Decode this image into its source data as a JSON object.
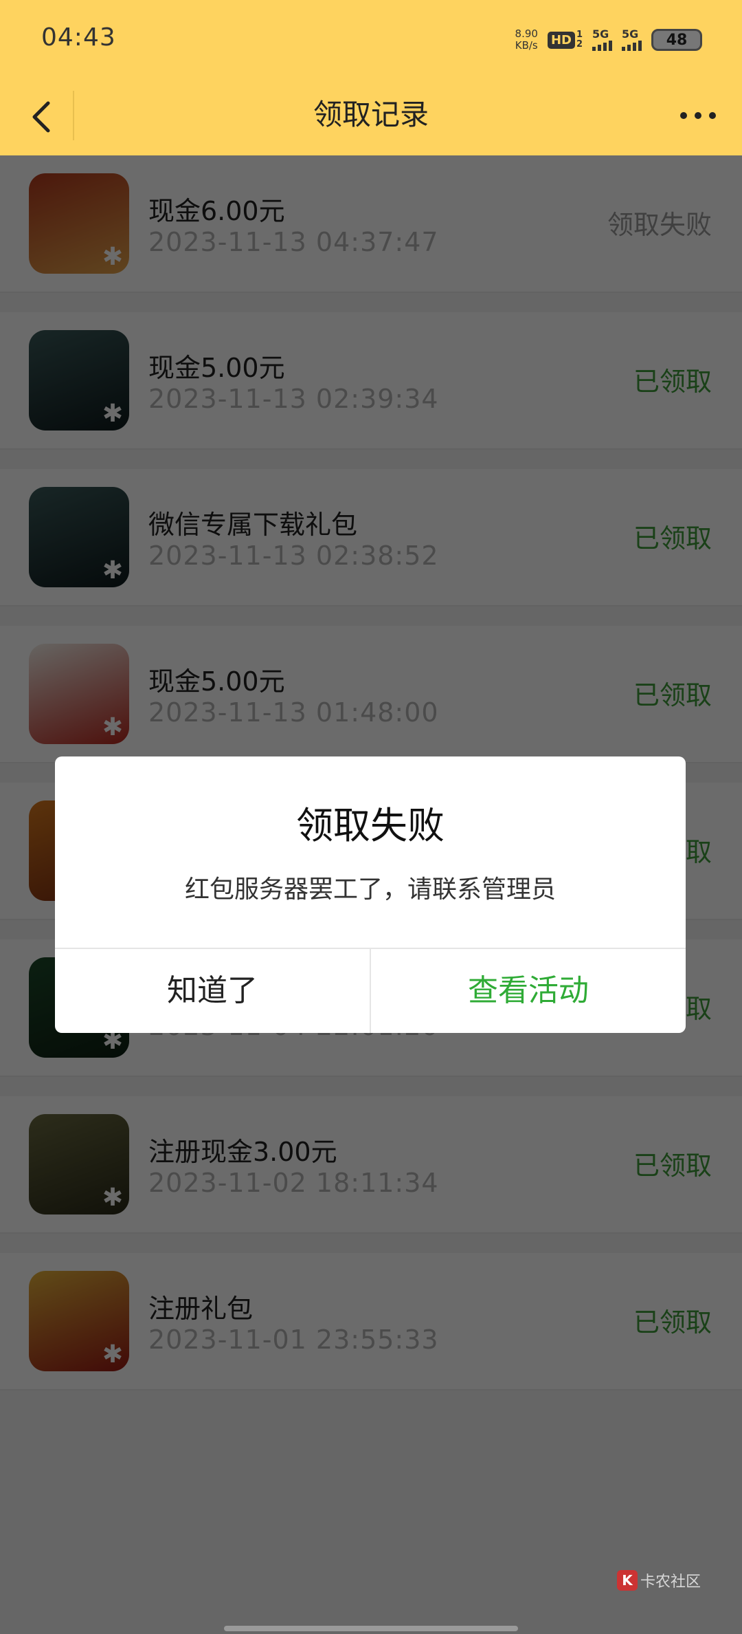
{
  "status_bar": {
    "time": "04:43",
    "net_speed_value": "8.90",
    "net_speed_unit": "KB/s",
    "hd_label": "HD",
    "hd_sub_top": "1",
    "hd_sub_bottom": "2",
    "signal1_label": "5G",
    "signal2_label": "5G",
    "battery": "48"
  },
  "nav": {
    "title": "领取记录",
    "back_icon": "chevron-left-icon",
    "more_icon": "more-dots-icon"
  },
  "records": [
    {
      "name": "现金6.00元",
      "date": "2023-11-13 04:37:47",
      "status": "领取失败",
      "status_type": "fail",
      "icon": "game-icon-warrior",
      "icon_colors": [
        "#b33a1e",
        "#e2a24a"
      ]
    },
    {
      "name": "现金5.00元",
      "date": "2023-11-13 02:39:34",
      "status": "已领取",
      "status_type": "ok",
      "icon": "game-icon-forest",
      "icon_colors": [
        "#3a5a5a",
        "#0e1a1c"
      ]
    },
    {
      "name": "微信专属下载礼包",
      "date": "2023-11-13 02:38:52",
      "status": "已领取",
      "status_type": "ok",
      "icon": "game-icon-forest",
      "icon_colors": [
        "#3a5a5a",
        "#0e1a1c"
      ]
    },
    {
      "name": "现金5.00元",
      "date": "2023-11-13 01:48:00",
      "status": "已领取",
      "status_type": "ok",
      "icon": "game-icon-empire",
      "icon_colors": [
        "#f3efe8",
        "#b7281e"
      ]
    },
    {
      "name": "",
      "date": "",
      "status": "已领取",
      "status_type": "ok",
      "icon": "game-icon-obscured",
      "icon_colors": [
        "#d97a1e",
        "#7a2a10"
      ]
    },
    {
      "name": "",
      "date": "2023-11-04 22:01:20",
      "status": "已领取",
      "status_type": "ok",
      "icon": "game-icon-football",
      "icon_colors": [
        "#1d4a2a",
        "#0d1f12"
      ]
    },
    {
      "name": "注册现金3.00元",
      "date": "2023-11-02 18:11:34",
      "status": "已领取",
      "status_type": "ok",
      "icon": "game-icon-call-of-duty",
      "icon_colors": [
        "#6a6a40",
        "#2a2a18"
      ]
    },
    {
      "name": "注册礼包",
      "date": "2023-11-01 23:55:33",
      "status": "已领取",
      "status_type": "ok",
      "icon": "game-icon-dragon",
      "icon_colors": [
        "#e5b23a",
        "#9b1a14"
      ]
    }
  ],
  "dialog": {
    "title": "领取失败",
    "message": "红包服务器罢工了，请联系管理员",
    "button_left": "知道了",
    "button_right": "查看活动",
    "accent": "#2fab36"
  },
  "watermark": {
    "logo_letter": "K",
    "text": "卡农社区"
  },
  "colors": {
    "header": "#fed35f",
    "success": "#3e9b3a",
    "fail": "#9a9a9a"
  }
}
